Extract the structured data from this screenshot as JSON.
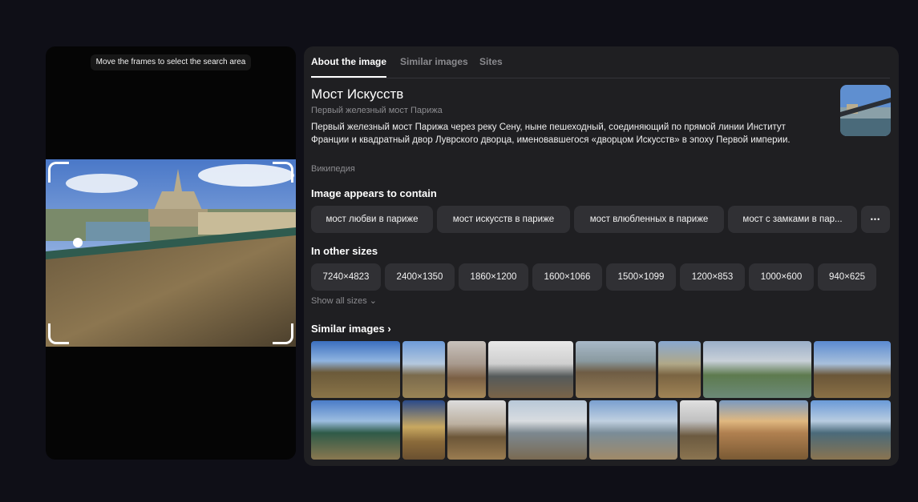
{
  "preview": {
    "hint": "Move the frames to select the search area"
  },
  "tabs": [
    "About the image",
    "Similar images",
    "Sites"
  ],
  "entity": {
    "title": "Мост Искусств",
    "subtitle": "Первый железный мост Парижа",
    "description": "Первый железный мост Парижа через реку Сену, ныне пешеходный, соединяющий по прямой линии Институт Франции и квадратный двор Луврского дворца, именовавшегося «дворцом Искусств» в эпоху Первой империи.",
    "source": "Википедия"
  },
  "contains": {
    "heading": "Image appears to contain",
    "tags": [
      "мост любви в париже",
      "мост искусств в париже",
      "мост влюбленных в париже",
      "мост с замками в пар..."
    ],
    "more": "•••"
  },
  "sizes": {
    "heading": "In other sizes",
    "items": [
      "7240×4823",
      "2400×1350",
      "1860×1200",
      "1600×1066",
      "1500×1099",
      "1200×853",
      "1000×600",
      "940×625"
    ],
    "show_all": "Show all sizes ⌄"
  },
  "similar": {
    "heading": "Similar images ›"
  },
  "colors": {
    "background": "#0f0f17",
    "panel": "#1f1f22",
    "chip": "#303034",
    "muted": "#8c8c90"
  }
}
